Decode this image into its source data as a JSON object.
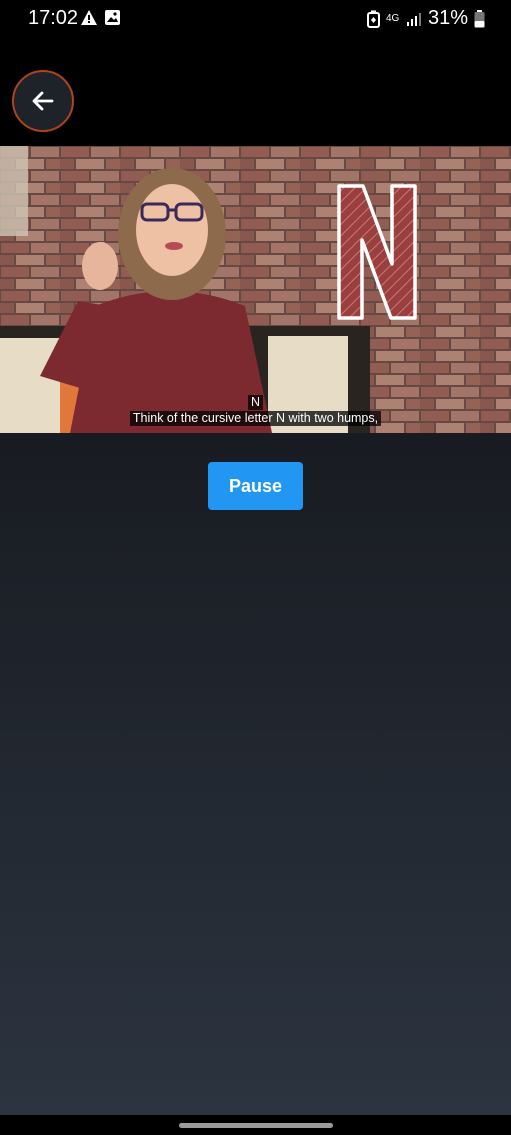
{
  "status_bar": {
    "time": "17:02",
    "network": "4G",
    "battery": "31%",
    "icons": [
      "warning-icon",
      "image-icon",
      "battery-saver-icon",
      "network-4g-icon",
      "signal-icon",
      "battery-icon"
    ]
  },
  "header": {
    "back_icon": "arrow-left-icon",
    "accent_color": "#b0431c"
  },
  "video": {
    "overlay_letter": "N",
    "caption_top": "N",
    "caption_bottom": "Think of the cursive letter N with two humps,"
  },
  "controls": {
    "pause_label": "Pause",
    "button_color": "#2196f3"
  }
}
